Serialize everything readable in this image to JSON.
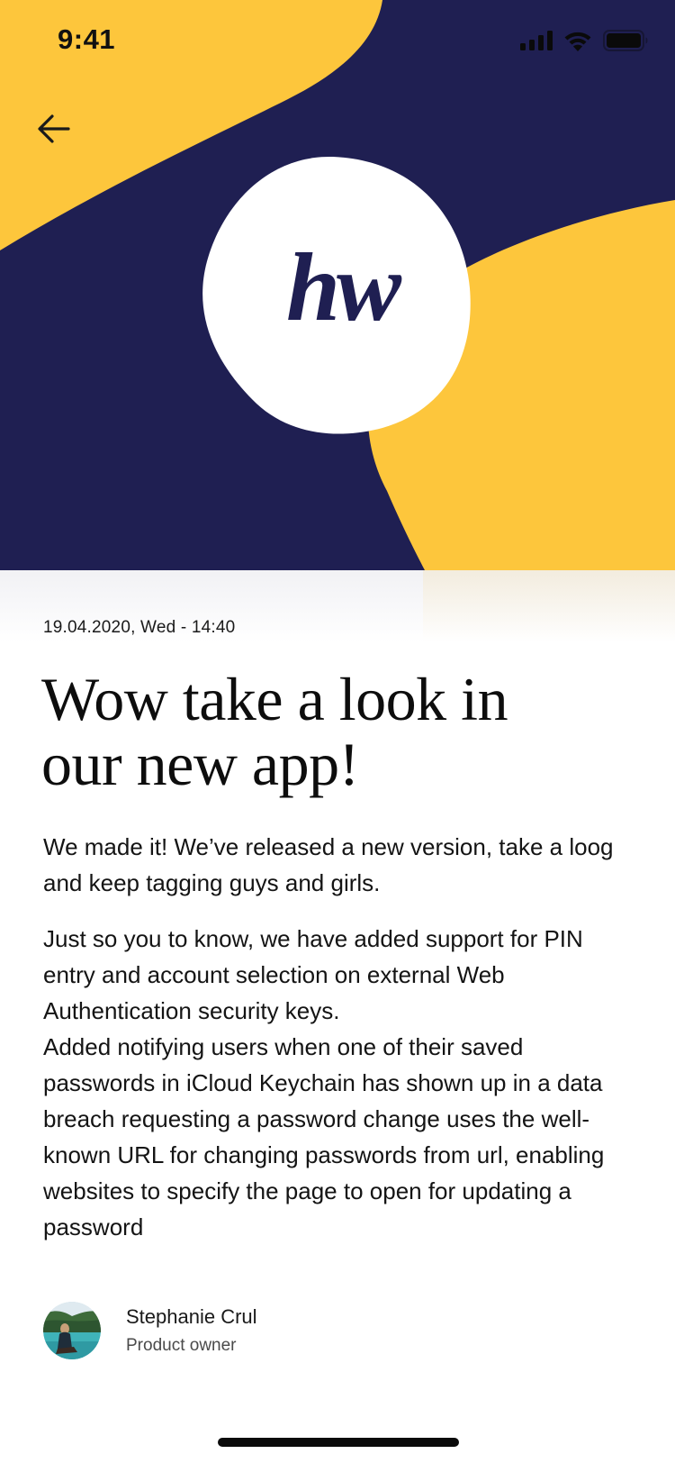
{
  "status_bar": {
    "time": "9:41"
  },
  "hero": {
    "logo_text": "hw"
  },
  "colors": {
    "navy": "#1F1F52",
    "yellow": "#FDC63C",
    "white": "#FFFFFF"
  },
  "icons": {
    "back": "arrow-left-icon",
    "signal": "cellular-signal-icon",
    "wifi": "wifi-icon",
    "battery": "battery-icon"
  },
  "article": {
    "date": "19.04.2020, Wed - 14:40",
    "title_line1": "Wow take a look in",
    "title_line2": "our new app!",
    "paragraph1": "We made it! We’ve released a new version, take a loog and keep tagging guys and girls.",
    "paragraph2": "Just so you to know, we have added support for PIN entry and account selection on external Web Authentication security keys.",
    "paragraph3": "Added notifying users when one of their saved passwords in iCloud Keychain has shown up in a data breach requesting a password change uses the well-known URL for changing passwords from url, enabling websites to specify the page to open for updating a password"
  },
  "author": {
    "name": "Stephanie Crul",
    "role": "Product owner"
  }
}
